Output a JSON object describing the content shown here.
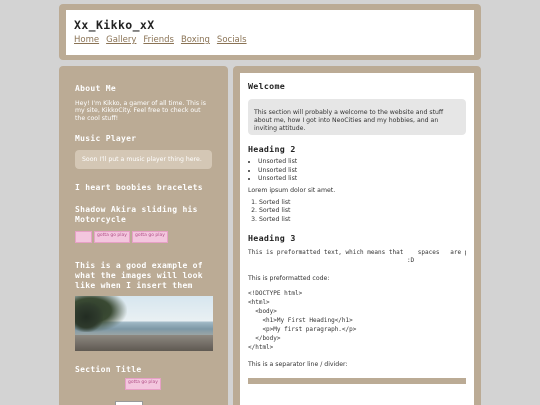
{
  "header": {
    "title": "Xx_Kikko_xX",
    "nav": [
      "Home",
      "Gallery",
      "Friends",
      "Boxing",
      "Socials"
    ]
  },
  "sidebar": {
    "about_title": "About Me",
    "about_text": "Hey! I'm Kikko, a gamer of all time. This is my site, KikkoCity. Feel free to check out the cool stuff!",
    "music_title": "Music Player",
    "music_text": "Soon I'll put a music player thing here.",
    "bracelets_title": "I heart boobies bracelets",
    "shadow_title": "Shadow Akira sliding his Motorcycle",
    "blinkie_text": "gotta go play",
    "image_caption": "This is a good example of what the images will look like when I insert them",
    "section_title": "Section Title"
  },
  "main": {
    "welcome_title": "Welcome",
    "welcome_text": "This section will probably a welcome to the website and stuff about me, how I got into NeoCities and my hobbies, and an inviting attitude.",
    "heading2": "Heading 2",
    "unsorted": [
      "Unsorted list",
      "Unsorted list",
      "Unsorted list"
    ],
    "lorem": "Lorem ipsum dolor sit amet.",
    "sorted": [
      "Sorted list",
      "Sorted list",
      "Sorted list"
    ],
    "heading3": "Heading 3",
    "pre_text": "This is preformatted text, which means that    spaces   are preserved\n                                            :D",
    "code_intro": "This is preformatted code:",
    "code": "<!DOCTYPE html>\n<html>\n  <body>\n    <h1>My First Heading</h1>\n    <p>My first paragraph.</p>\n  </body>\n</html>",
    "separator_text": "This is a separator line / divider:"
  },
  "colors": {
    "frame": "#bbab95",
    "background": "#d3d3d3",
    "nav_link": "#8a7355"
  }
}
